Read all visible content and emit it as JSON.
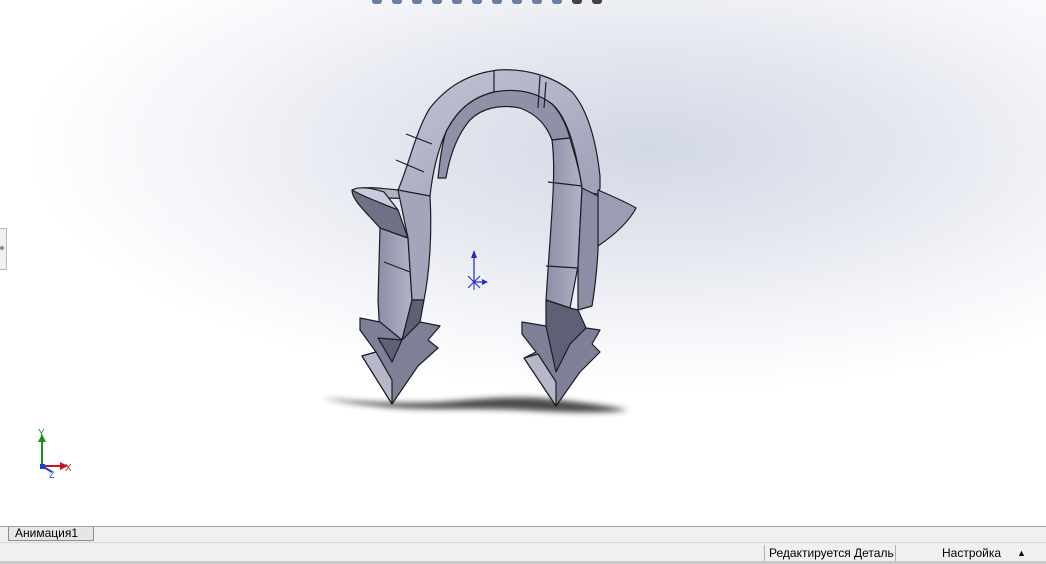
{
  "viewport": {
    "model": "pipe-clip-arrow-part",
    "triad_axes": {
      "y": "Y",
      "x": "X",
      "z": "Z"
    },
    "colors": {
      "part_face_light": "#b7b9cc",
      "part_face_mid": "#9a9db3",
      "part_face_dark": "#6f7187",
      "part_edge": "#1c1c24",
      "shadow": "#2a2a2a",
      "origin_blue": "#1b2cc9",
      "triad_x": "#c8141e",
      "triad_y": "#1a8f1a",
      "triad_z": "#1a3fd8"
    }
  },
  "tabs": {
    "animation": "Анимация1"
  },
  "status": {
    "mode": "Редактируется Деталь",
    "units": "Настройка",
    "arrow": "▲"
  }
}
